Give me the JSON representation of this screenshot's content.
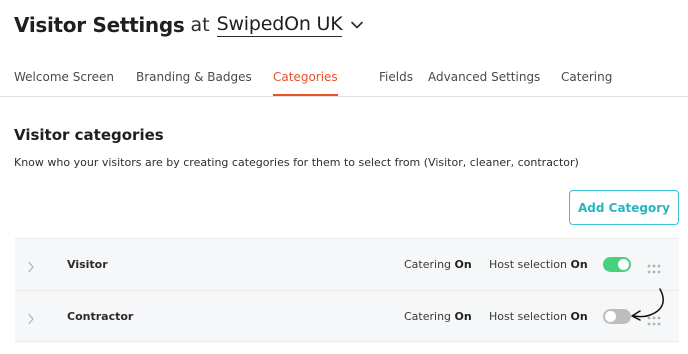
{
  "header": {
    "title": "Visitor Settings",
    "at": "at",
    "location": "SwipedOn UK"
  },
  "tabs": [
    {
      "label": "Welcome Screen",
      "active": false
    },
    {
      "label": "Branding & Badges",
      "active": false
    },
    {
      "label": "Categories",
      "active": true
    },
    {
      "label": "Fields",
      "active": false
    },
    {
      "label": "Advanced Settings",
      "active": false
    },
    {
      "label": "Catering",
      "active": false
    }
  ],
  "section": {
    "title": "Visitor categories",
    "description": "Know who your visitors are by creating categories for them to select from (Visitor, cleaner, contractor)"
  },
  "add_button": {
    "label": "Add Category"
  },
  "categories": [
    {
      "name": "Visitor",
      "catering_label": "Catering",
      "catering_state": "On",
      "host_label": "Host selection",
      "host_state": "On",
      "enabled": true
    },
    {
      "name": "Contractor",
      "catering_label": "Catering",
      "catering_state": "On",
      "host_label": "Host selection",
      "host_state": "On",
      "enabled": false
    }
  ],
  "colors": {
    "accent_active_tab": "#e8502a",
    "button_teal": "#3cc3cf",
    "toggle_on": "#47d17a",
    "toggle_off": "#bdbdbd"
  }
}
